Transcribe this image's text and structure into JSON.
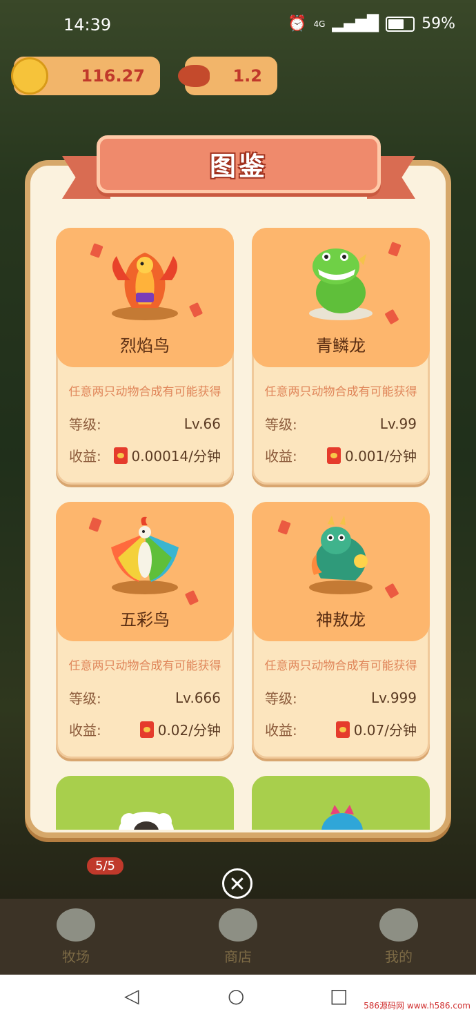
{
  "status": {
    "time": "14:39",
    "battery": "59%",
    "network": "4G"
  },
  "hud": {
    "coins": "116.27",
    "meat": "1.2"
  },
  "modal": {
    "title": "图鉴"
  },
  "cards": [
    {
      "name": "烈焰鸟",
      "desc": "任意两只动物合成有可能获得",
      "level_label": "等级:",
      "level": "Lv.66",
      "income_label": "收益:",
      "income": "0.00014/分钟",
      "color": "#f0642a"
    },
    {
      "name": "青鳞龙",
      "desc": "任意两只动物合成有可能获得",
      "level_label": "等级:",
      "level": "Lv.99",
      "income_label": "收益:",
      "income": "0.001/分钟",
      "color": "#5fbf3a"
    },
    {
      "name": "五彩鸟",
      "desc": "任意两只动物合成有可能获得",
      "level_label": "等级:",
      "level": "Lv.666",
      "income_label": "收益:",
      "income": "0.02/分钟",
      "color": "#3ab5d0"
    },
    {
      "name": "神敖龙",
      "desc": "任意两只动物合成有可能获得",
      "level_label": "等级:",
      "level": "Lv.999",
      "income_label": "收益:",
      "income": "0.07/分钟",
      "color": "#2f9a7a"
    }
  ],
  "bottom": {
    "badge": "5/5",
    "tabs": [
      "牧场",
      "商店",
      "我的"
    ]
  },
  "watermark": "586源码网 www.h586.com"
}
